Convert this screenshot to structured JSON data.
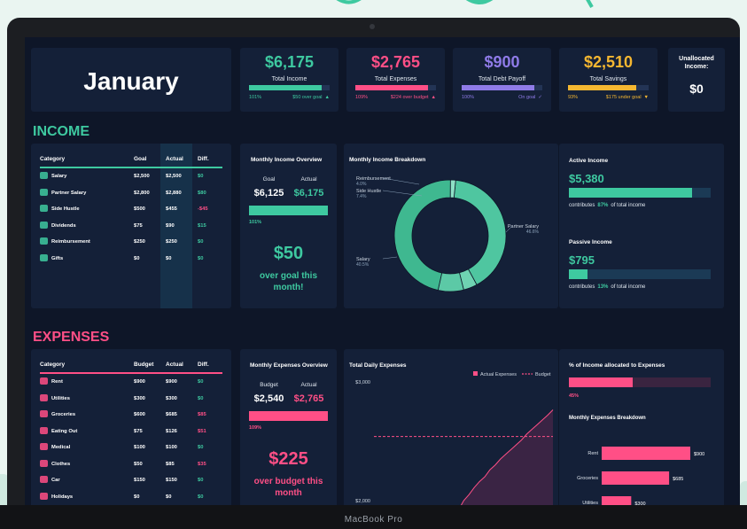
{
  "header": {
    "month": "January",
    "kpis": [
      {
        "value": "$6,175",
        "label": "Total Income",
        "pct": "101%",
        "status": "$50 over goal",
        "arrow": "▲",
        "color": "#3ec9a0",
        "fill": 0.9
      },
      {
        "value": "$2,765",
        "label": "Total Expenses",
        "pct": "109%",
        "status": "$224 over budget",
        "arrow": "▲",
        "color": "#ff4f86",
        "fill": 0.9
      },
      {
        "value": "$900",
        "label": "Total Debt Payoff",
        "pct": "100%",
        "status": "On goal",
        "arrow": "✓",
        "color": "#8f7be8",
        "fill": 0.9
      },
      {
        "value": "$2,510",
        "label": "Total Savings",
        "pct": "93%",
        "status": "$175 under goal",
        "arrow": "▼",
        "color": "#f5b731",
        "fill": 0.85
      }
    ],
    "unallocated_label": "Unallocated Income:",
    "unallocated_value": "$0"
  },
  "income": {
    "section_title": "INCOME",
    "table": {
      "headers": [
        "Category",
        "Goal",
        "Actual",
        "Diff."
      ],
      "rows": [
        {
          "name": "Salary",
          "goal": "$2,500",
          "actual": "$2,500",
          "diff": "$0",
          "icon": "money-icon"
        },
        {
          "name": "Partner Salary",
          "goal": "$2,800",
          "actual": "$2,880",
          "diff": "$80",
          "icon": "people-icon"
        },
        {
          "name": "Side Hustle",
          "goal": "$500",
          "actual": "$455",
          "diff": "-$45",
          "icon": "briefcase-icon"
        },
        {
          "name": "Dividends",
          "goal": "$75",
          "actual": "$90",
          "diff": "$15",
          "icon": "chart-icon"
        },
        {
          "name": "Reimbursement",
          "goal": "$250",
          "actual": "$250",
          "diff": "$0",
          "icon": "receipt-icon"
        },
        {
          "name": "Gifts",
          "goal": "$0",
          "actual": "$0",
          "diff": "$0",
          "icon": "gift-icon"
        }
      ]
    },
    "overview": {
      "title": "Monthly Income Overview",
      "goal_label": "Goal",
      "actual_label": "Actual",
      "goal_value": "$6,125",
      "actual_value": "$6,175",
      "pct": "101%",
      "big_value": "$50",
      "big_text": "over goal this month!"
    },
    "breakdown": {
      "title": "Monthly Income Breakdown",
      "slices": [
        {
          "name": "Salary",
          "pct": 40.5,
          "label": "40.5%"
        },
        {
          "name": "Reimbursement",
          "pct": 4.0,
          "label": "4.0%"
        },
        {
          "name": "Side Hustle",
          "pct": 7.4,
          "label": "7.4%"
        },
        {
          "name": "Partner Salary",
          "pct": 46.6,
          "label": "46.6%"
        },
        {
          "name": "Dividends",
          "pct": 1.5,
          "label": ""
        }
      ]
    },
    "active": {
      "title": "Active Income",
      "value": "$5,380",
      "pct": "87%",
      "fill": 0.87,
      "foot_a": "contributes",
      "foot_b": "of total income"
    },
    "passive": {
      "title": "Passive Income",
      "value": "$795",
      "pct": "13%",
      "fill": 0.13,
      "foot_a": "contributes",
      "foot_b": "of total income"
    }
  },
  "expenses": {
    "section_title": "EXPENSES",
    "table": {
      "headers": [
        "Category",
        "Budget",
        "Actual",
        "Diff."
      ],
      "rows": [
        {
          "name": "Rent",
          "budget": "$900",
          "actual": "$900",
          "diff": "$0",
          "icon": "home-icon"
        },
        {
          "name": "Utilities",
          "budget": "$300",
          "actual": "$300",
          "diff": "$0",
          "icon": "bolt-icon"
        },
        {
          "name": "Groceries",
          "budget": "$600",
          "actual": "$685",
          "diff": "$85",
          "icon": "cart-icon"
        },
        {
          "name": "Eating Out",
          "budget": "$75",
          "actual": "$126",
          "diff": "$51",
          "icon": "food-icon"
        },
        {
          "name": "Medical",
          "budget": "$100",
          "actual": "$100",
          "diff": "$0",
          "icon": "heart-icon"
        },
        {
          "name": "Clothes",
          "budget": "$50",
          "actual": "$85",
          "diff": "$35",
          "icon": "shirt-icon"
        },
        {
          "name": "Car",
          "budget": "$150",
          "actual": "$150",
          "diff": "$0",
          "icon": "car-icon"
        },
        {
          "name": "Holidays",
          "budget": "$0",
          "actual": "$0",
          "diff": "$0",
          "icon": "plane-icon"
        }
      ]
    },
    "overview": {
      "title": "Monthly Expenses Overview",
      "budget_label": "Budget",
      "actual_label": "Actual",
      "budget_value": "$2,540",
      "actual_value": "$2,765",
      "pct": "109%",
      "big_value": "$225",
      "big_text": "over budget this month"
    },
    "daily": {
      "title": "Total Daily Expenses",
      "legend_actual": "Actual Expenses",
      "legend_budget": "Budget",
      "y_ticks": [
        "$3,000",
        "$2,000"
      ],
      "budget_value": 2540,
      "y_top": 3000,
      "y_mid": 2000,
      "y_min": 1600,
      "actual_points": [
        1600,
        1620,
        1650,
        1700,
        1760,
        1800,
        1870,
        1920,
        2000,
        2050,
        2110,
        2160,
        2200,
        2260,
        2300,
        2350,
        2390,
        2430,
        2470,
        2510,
        2560,
        2600,
        2640,
        2680,
        2720,
        2765
      ]
    },
    "allocation": {
      "title": "% of Income allocated to Expenses",
      "pct": "45%",
      "fill": 0.45
    },
    "breakdown": {
      "title": "Monthly Expenses Breakdown",
      "bars": [
        {
          "name": "Rent",
          "value": 900,
          "label": "$900"
        },
        {
          "name": "Groceries",
          "value": 685,
          "label": "$685"
        },
        {
          "name": "Utilities",
          "value": 300,
          "label": "$300"
        }
      ]
    }
  },
  "device_label": "MacBook Pro",
  "colors": {
    "income": "#3ec9a0",
    "expense": "#ff4f86",
    "bg": "#0e1628",
    "card": "#142038"
  }
}
